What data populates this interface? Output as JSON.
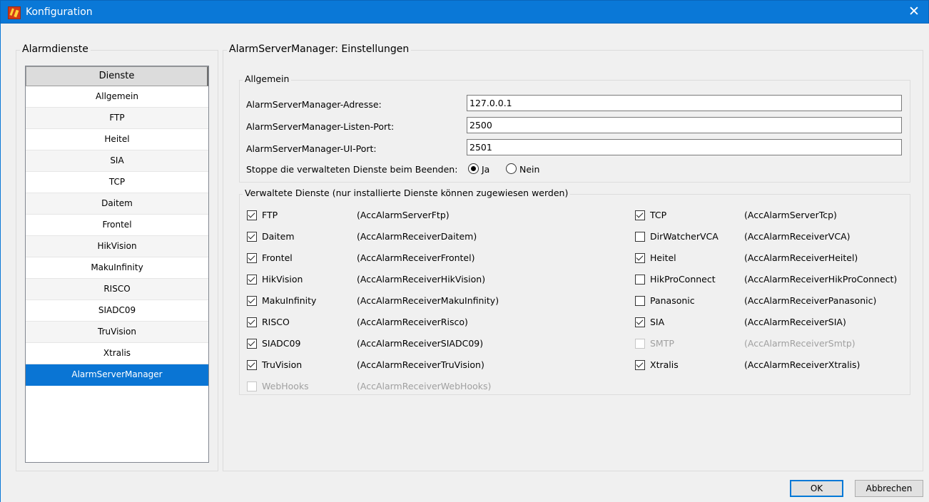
{
  "window": {
    "title": "Konfiguration",
    "close_glyph": "✕"
  },
  "left_panel": {
    "title": "Alarmdienste",
    "header": "Dienste",
    "items": [
      "Allgemein",
      "FTP",
      "Heitel",
      "SIA",
      "TCP",
      "Daitem",
      "Frontel",
      "HikVision",
      "MakuInfinity",
      "RISCO",
      "SIADC09",
      "TruVision",
      "Xtralis",
      "AlarmServerManager"
    ],
    "selected": "AlarmServerManager"
  },
  "settings": {
    "title": "AlarmServerManager: Einstellungen",
    "general": {
      "title": "Allgemein",
      "fields": [
        {
          "label": "AlarmServerManager-Adresse:",
          "value": "127.0.0.1"
        },
        {
          "label": "AlarmServerManager-Listen-Port:",
          "value": "2500"
        },
        {
          "label": "AlarmServerManager-UI-Port:",
          "value": "2501"
        }
      ],
      "stop_label": "Stoppe die verwalteten Dienste beim Beenden:",
      "yes": "Ja",
      "no": "Nein"
    },
    "managed": {
      "title": "Verwaltete Dienste (nur installierte Dienste können zugewiesen werden)",
      "left": [
        {
          "name": "FTP",
          "id": "(AccAlarmServerFtp)",
          "checked": true,
          "enabled": true
        },
        {
          "name": "Daitem",
          "id": "(AccAlarmReceiverDaitem)",
          "checked": true,
          "enabled": true
        },
        {
          "name": "Frontel",
          "id": "(AccAlarmReceiverFrontel)",
          "checked": true,
          "enabled": true
        },
        {
          "name": "HikVision",
          "id": "(AccAlarmReceiverHikVision)",
          "checked": true,
          "enabled": true
        },
        {
          "name": "MakuInfinity",
          "id": "(AccAlarmReceiverMakuInfinity)",
          "checked": true,
          "enabled": true
        },
        {
          "name": "RISCO",
          "id": "(AccAlarmReceiverRisco)",
          "checked": true,
          "enabled": true
        },
        {
          "name": "SIADC09",
          "id": "(AccAlarmReceiverSIADC09)",
          "checked": true,
          "enabled": true
        },
        {
          "name": "TruVision",
          "id": "(AccAlarmReceiverTruVision)",
          "checked": true,
          "enabled": true
        },
        {
          "name": "WebHooks",
          "id": "(AccAlarmReceiverWebHooks)",
          "checked": false,
          "enabled": false
        }
      ],
      "right": [
        {
          "name": "TCP",
          "id": "(AccAlarmServerTcp)",
          "checked": true,
          "enabled": true
        },
        {
          "name": "DirWatcherVCA",
          "id": "(AccAlarmReceiverVCA)",
          "checked": false,
          "enabled": true
        },
        {
          "name": "Heitel",
          "id": "(AccAlarmReceiverHeitel)",
          "checked": true,
          "enabled": true
        },
        {
          "name": "HikProConnect",
          "id": "(AccAlarmReceiverHikProConnect)",
          "checked": false,
          "enabled": true
        },
        {
          "name": "Panasonic",
          "id": "(AccAlarmReceiverPanasonic)",
          "checked": false,
          "enabled": true
        },
        {
          "name": "SIA",
          "id": "(AccAlarmReceiverSIA)",
          "checked": true,
          "enabled": true
        },
        {
          "name": "SMTP",
          "id": "(AccAlarmReceiverSmtp)",
          "checked": false,
          "enabled": false
        },
        {
          "name": "Xtralis",
          "id": "(AccAlarmReceiverXtralis)",
          "checked": true,
          "enabled": true
        }
      ]
    }
  },
  "buttons": {
    "ok": "OK",
    "cancel": "Abbrechen"
  }
}
